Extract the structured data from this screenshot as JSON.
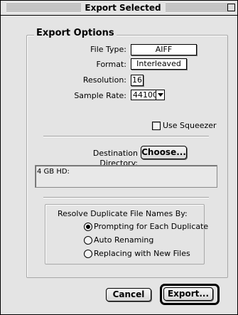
{
  "window": {
    "title": "Export Selected"
  },
  "export_options": {
    "group_title": "Export Options",
    "file_type": {
      "label": "File Type:",
      "value": "AIFF"
    },
    "format": {
      "label": "Format:",
      "value": "Interleaved"
    },
    "resolution": {
      "label": "Resolution:",
      "value": "16"
    },
    "sample_rate": {
      "label": "Sample Rate:",
      "value": "44100"
    },
    "use_squeezer": {
      "label": "Use Squeezer",
      "checked": false
    },
    "destination": {
      "label": "Destination Directory:",
      "choose_label": "Choose...",
      "path": "4 GB HD:"
    },
    "duplicates": {
      "label": "Resolve Duplicate File Names By:",
      "options": [
        {
          "label": "Prompting for Each Duplicate",
          "selected": true
        },
        {
          "label": "Auto Renaming",
          "selected": false
        },
        {
          "label": "Replacing with New Files",
          "selected": false
        }
      ]
    }
  },
  "buttons": {
    "cancel": "Cancel",
    "export": "Export..."
  }
}
